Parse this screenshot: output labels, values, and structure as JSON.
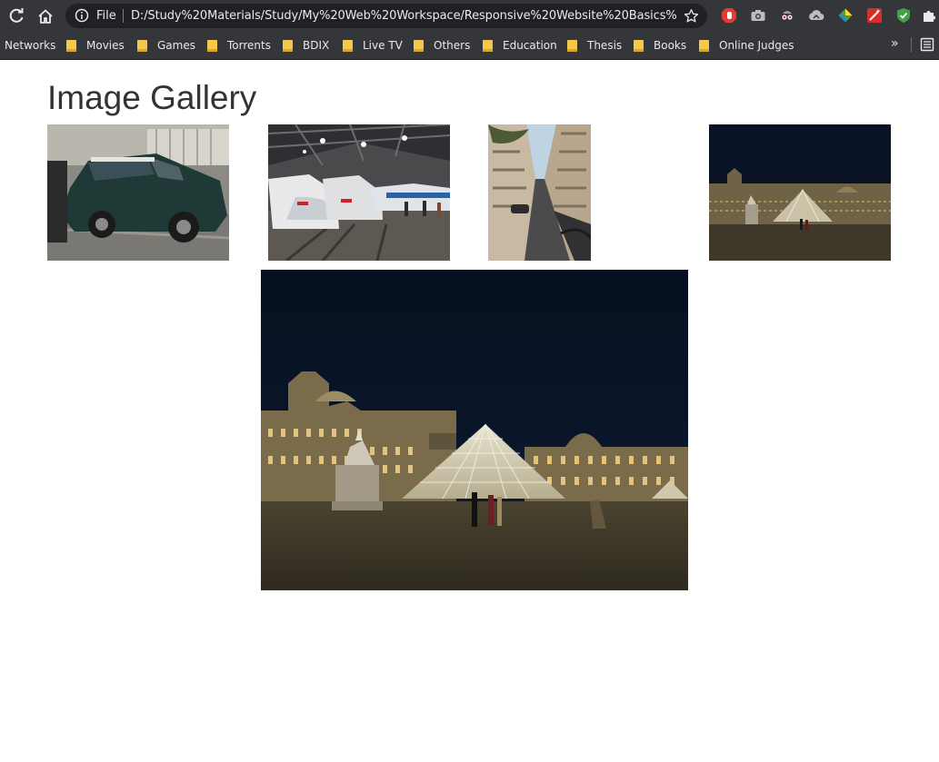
{
  "browser": {
    "address_prefix": "File",
    "url": "D:/Study%20Materials/Study/My%20Web%20Workspace/Responsive%20Website%20Basics%2...",
    "bookmarks": [
      "Networks",
      "Movies",
      "Games",
      "Torrents",
      "BDIX",
      "Live TV",
      "Others",
      "Education",
      "Thesis",
      "Books",
      "Online Judges"
    ],
    "more_label": "»"
  },
  "page": {
    "title": "Image Gallery"
  },
  "gallery": {
    "thumbnails": [
      "car-photo",
      "train-station-photo",
      "street-photo",
      "louvre-pyramid-photo"
    ],
    "featured": "louvre-pyramid-large-photo"
  },
  "icons": {
    "reload": "reload-icon",
    "home": "home-icon",
    "info": "info-icon",
    "star": "star-icon",
    "reading_list": "reading-list-icon"
  },
  "colors": {
    "chrome": "#35363a",
    "omnibox": "#202124",
    "folder": "#f4c84a",
    "title_text": "#333333"
  }
}
